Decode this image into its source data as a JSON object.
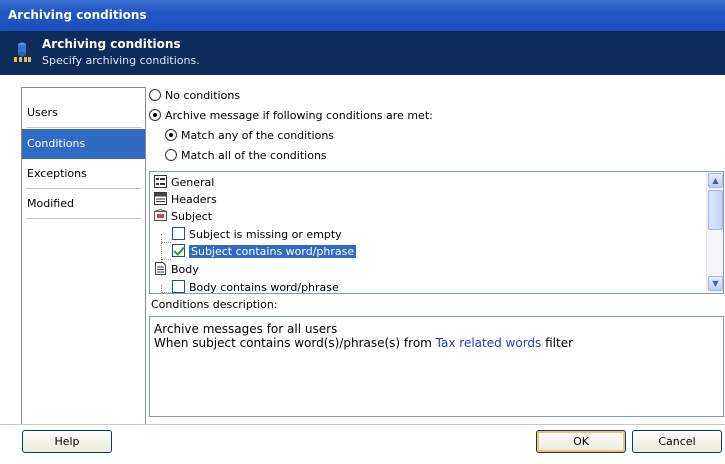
{
  "window": {
    "title": "Archiving conditions"
  },
  "header": {
    "title": "Archiving conditions",
    "subtitle": "Specify archiving conditions.",
    "icon": "archive-icon"
  },
  "nav": {
    "items": [
      {
        "label": "Users",
        "active": false
      },
      {
        "label": "Conditions",
        "active": true
      },
      {
        "label": "Exceptions",
        "active": false
      },
      {
        "label": "Modified",
        "active": false
      }
    ]
  },
  "options": {
    "no_conditions": "No conditions",
    "archive_if": "Archive message if following conditions are met:",
    "match_any": "Match any of the conditions",
    "match_all": "Match all of the conditions"
  },
  "tree": {
    "general": "General",
    "headers": "Headers",
    "subject": "Subject",
    "subject_missing": "Subject is missing or empty",
    "subject_contains": "Subject contains word/phrase",
    "body": "Body",
    "body_contains": "Body contains word/phrase"
  },
  "description": {
    "label": "Conditions description:",
    "line1": "Archive messages for all users",
    "line2_prefix": "When subject contains word(s)/phrase(s) from ",
    "line2_link": "Tax related words",
    "line2_suffix": " filter"
  },
  "buttons": {
    "help": "Help",
    "ok": "OK",
    "cancel": "Cancel"
  },
  "colors": {
    "title_bar": "#2357c3",
    "header_band": "#0f2b5b",
    "selection": "#316ac5",
    "link": "#2637c7"
  }
}
